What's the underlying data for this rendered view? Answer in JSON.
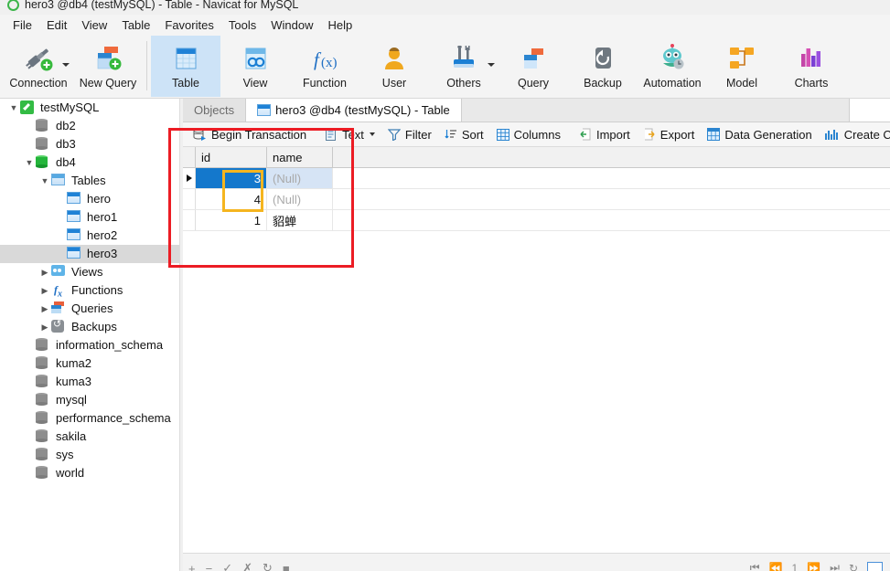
{
  "window": {
    "title": "hero3 @db4 (testMySQL) - Table - Navicat for MySQL",
    "app_icon": "navicat-circle-icon"
  },
  "menubar": {
    "items": [
      {
        "label": "File"
      },
      {
        "label": "Edit"
      },
      {
        "label": "View"
      },
      {
        "label": "Table"
      },
      {
        "label": "Favorites"
      },
      {
        "label": "Tools"
      },
      {
        "label": "Window"
      },
      {
        "label": "Help"
      }
    ]
  },
  "toolbar": {
    "items": [
      {
        "label": "Connection",
        "icon": "connection-plug-icon",
        "selected": false,
        "has_caret": true
      },
      {
        "label": "New Query",
        "icon": "new-query-icon",
        "selected": false,
        "has_caret": false
      },
      {
        "label": "Table",
        "icon": "table-icon",
        "selected": true,
        "has_caret": false
      },
      {
        "label": "View",
        "icon": "view-icon",
        "selected": false,
        "has_caret": false
      },
      {
        "label": "Function",
        "icon": "function-fx-icon",
        "selected": false,
        "has_caret": false
      },
      {
        "label": "User",
        "icon": "user-icon",
        "selected": false,
        "has_caret": false
      },
      {
        "label": "Others",
        "icon": "others-tools-icon",
        "selected": false,
        "has_caret": true
      },
      {
        "label": "Query",
        "icon": "query-icon",
        "selected": false,
        "has_caret": false
      },
      {
        "label": "Backup",
        "icon": "backup-icon",
        "selected": false,
        "has_caret": false
      },
      {
        "label": "Automation",
        "icon": "automation-robot-icon",
        "selected": false,
        "has_caret": false
      },
      {
        "label": "Model",
        "icon": "model-icon",
        "selected": false,
        "has_caret": false
      },
      {
        "label": "Charts",
        "icon": "charts-icon",
        "selected": false,
        "has_caret": false
      }
    ]
  },
  "sidebar": {
    "items": [
      {
        "label": "testMySQL",
        "icon": "connection-icon",
        "indent": 0,
        "chevron": "down",
        "selected": false
      },
      {
        "label": "db2",
        "icon": "database-icon",
        "indent": 1,
        "chevron": "none",
        "selected": false
      },
      {
        "label": "db3",
        "icon": "database-icon",
        "indent": 1,
        "chevron": "none",
        "selected": false
      },
      {
        "label": "db4",
        "icon": "database-open-icon",
        "indent": 1,
        "chevron": "down",
        "selected": false
      },
      {
        "label": "Tables",
        "icon": "tables-folder-icon",
        "indent": 2,
        "chevron": "down",
        "selected": false
      },
      {
        "label": "hero",
        "icon": "table-icon",
        "indent": 3,
        "chevron": "none",
        "selected": false
      },
      {
        "label": "hero1",
        "icon": "table-icon",
        "indent": 3,
        "chevron": "none",
        "selected": false
      },
      {
        "label": "hero2",
        "icon": "table-icon",
        "indent": 3,
        "chevron": "none",
        "selected": false
      },
      {
        "label": "hero3",
        "icon": "table-icon",
        "indent": 3,
        "chevron": "none",
        "selected": true
      },
      {
        "label": "Views",
        "icon": "views-icon",
        "indent": 2,
        "chevron": "right",
        "selected": false
      },
      {
        "label": "Functions",
        "icon": "functions-icon",
        "indent": 2,
        "chevron": "right",
        "selected": false
      },
      {
        "label": "Queries",
        "icon": "queries-icon",
        "indent": 2,
        "chevron": "right",
        "selected": false
      },
      {
        "label": "Backups",
        "icon": "backups-icon",
        "indent": 2,
        "chevron": "right",
        "selected": false
      },
      {
        "label": "information_schema",
        "icon": "database-icon",
        "indent": 1,
        "chevron": "none",
        "selected": false
      },
      {
        "label": "kuma2",
        "icon": "database-icon",
        "indent": 1,
        "chevron": "none",
        "selected": false
      },
      {
        "label": "kuma3",
        "icon": "database-icon",
        "indent": 1,
        "chevron": "none",
        "selected": false
      },
      {
        "label": "mysql",
        "icon": "database-icon",
        "indent": 1,
        "chevron": "none",
        "selected": false
      },
      {
        "label": "performance_schema",
        "icon": "database-icon",
        "indent": 1,
        "chevron": "none",
        "selected": false
      },
      {
        "label": "sakila",
        "icon": "database-icon",
        "indent": 1,
        "chevron": "none",
        "selected": false
      },
      {
        "label": "sys",
        "icon": "database-icon",
        "indent": 1,
        "chevron": "none",
        "selected": false
      },
      {
        "label": "world",
        "icon": "database-icon",
        "indent": 1,
        "chevron": "none",
        "selected": false
      }
    ]
  },
  "tabs": [
    {
      "label": "Objects",
      "active": false,
      "has_icon": false
    },
    {
      "label": "hero3 @db4 (testMySQL) - Table",
      "active": true,
      "has_icon": true
    }
  ],
  "gridbar": {
    "items": [
      {
        "label": "Begin Transaction",
        "icon": "transaction-icon",
        "caret": false
      },
      {
        "label": "Text",
        "icon": "text-icon",
        "caret": true
      },
      {
        "label": "Filter",
        "icon": "filter-icon",
        "caret": false
      },
      {
        "label": "Sort",
        "icon": "sort-icon",
        "caret": false
      },
      {
        "label": "Columns",
        "icon": "columns-icon",
        "caret": false
      },
      {
        "label": "Import",
        "icon": "import-icon",
        "caret": false
      },
      {
        "label": "Export",
        "icon": "export-icon",
        "caret": false
      },
      {
        "label": "Data Generation",
        "icon": "data-generation-icon",
        "caret": false
      },
      {
        "label": "Create Chart",
        "icon": "create-chart-icon",
        "caret": false
      }
    ]
  },
  "grid": {
    "columns": [
      {
        "label": "id",
        "width": 78,
        "align": "right"
      },
      {
        "label": "name",
        "width": 72,
        "align": "left"
      }
    ],
    "rows": [
      {
        "id": "3",
        "name": "(Null)",
        "name_is_null": true,
        "selected": true,
        "marker": true
      },
      {
        "id": "4",
        "name": "(Null)",
        "name_is_null": true,
        "selected": false,
        "marker": false
      },
      {
        "id": "1",
        "name": "貂蝉",
        "name_is_null": false,
        "selected": false,
        "marker": false
      }
    ]
  },
  "annotations": [
    {
      "name": "red-highlight-box",
      "color": "#ec1c24"
    },
    {
      "name": "yellow-highlight-box",
      "color": "#f5b51f"
    }
  ],
  "statusbar": {
    "left_buttons": [
      "add-record-icon",
      "delete-record-icon",
      "apply-change-icon",
      "cancel-change-icon",
      "refresh-icon",
      "stop-icon"
    ],
    "record_number": "1",
    "right_buttons": [
      "first-record-icon",
      "previous-record-icon",
      "next-record-icon",
      "last-record-icon",
      "refresh-grid-icon",
      "grid-view-icon"
    ]
  },
  "colors": {
    "accent_blue": "#1478cc",
    "selection_light_blue": "#d6e4f5",
    "toolbar_selected": "#cde3f7",
    "annotation_red": "#ec1c24",
    "annotation_yellow": "#f5b51f"
  }
}
